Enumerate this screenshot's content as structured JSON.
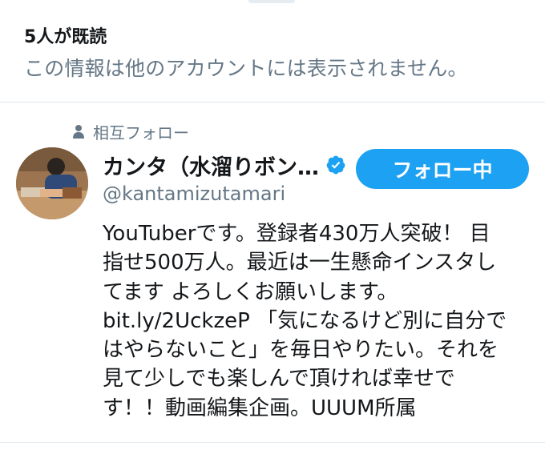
{
  "header": {
    "read_count": "5人が既読",
    "privacy_note": "この情報は他のアカウントには表示されません。"
  },
  "user": {
    "relationship_label": "相互フォロー",
    "display_name": "カンタ（水溜りボン…",
    "handle": "@kantamizutamari",
    "verified": true,
    "follow_button_label": "フォロー中",
    "bio_lines": [
      "YouTuberです。登録者430万人突破！ 目",
      "指せ500万人。最近は一生懸命インスタし",
      "てます よろしくお願いします。",
      "「気になるけど別に自分で",
      "はやらないこと」を毎日やりたい。それを",
      "見て少しでも楽しんで頂ければ幸せで",
      "す！！動画編集企画。UUUM所属"
    ],
    "bio_link": "bit.ly/2UckzeP"
  },
  "icons": {
    "relationship": "person-icon",
    "verified": "verified-badge-icon"
  },
  "colors": {
    "accent": "#1da1f2",
    "primary_text": "#14171a",
    "secondary_text": "#657786",
    "divider": "#e1e8ed"
  }
}
